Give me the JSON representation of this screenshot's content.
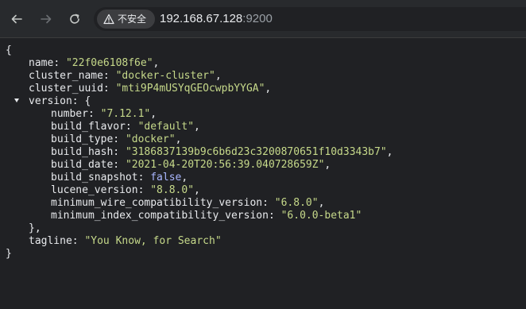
{
  "toolbar": {
    "back_icon": "arrow-left-icon",
    "forward_icon": "arrow-right-icon",
    "reload_icon": "reload-icon",
    "security_label": "不安全",
    "url_host": "192.168.67.128",
    "url_port": ":9200"
  },
  "json_view": {
    "open_brace": "{",
    "close_brace": "}",
    "entries": {
      "name": {
        "key": "name",
        "value": "\"22f0e6108f6e\""
      },
      "cluster_name": {
        "key": "cluster_name",
        "value": "\"docker-cluster\""
      },
      "cluster_uuid": {
        "key": "cluster_uuid",
        "value": "\"mti9P4mUSYqGEOcwpbYYGA\""
      },
      "version": {
        "key": "version",
        "open": "{",
        "close": "},"
      },
      "number": {
        "key": "number",
        "value": "\"7.12.1\""
      },
      "build_flavor": {
        "key": "build_flavor",
        "value": "\"default\""
      },
      "build_type": {
        "key": "build_type",
        "value": "\"docker\""
      },
      "build_hash": {
        "key": "build_hash",
        "value": "\"3186837139b9c6b6d23c3200870651f10d3343b7\""
      },
      "build_date": {
        "key": "build_date",
        "value": "\"2021-04-20T20:56:39.040728659Z\""
      },
      "build_snapshot": {
        "key": "build_snapshot",
        "value": "false"
      },
      "lucene_version": {
        "key": "lucene_version",
        "value": "\"8.8.0\""
      },
      "minimum_wire_compatibility_version": {
        "key": "minimum_wire_compatibility_version",
        "value": "\"6.8.0\""
      },
      "minimum_index_compatibility_version": {
        "key": "minimum_index_compatibility_version",
        "value": "\"6.0.0-beta1\""
      },
      "tagline": {
        "key": "tagline",
        "value": "\"You Know, for Search\""
      }
    }
  }
}
